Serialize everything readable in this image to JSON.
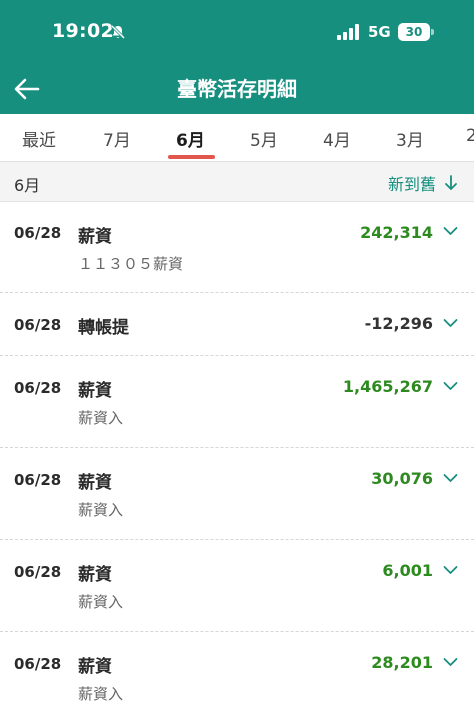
{
  "status_bar": {
    "time": "19:02",
    "network": "5G",
    "battery": "30"
  },
  "header": {
    "title": "臺幣活存明細"
  },
  "tabs": [
    {
      "label": "最近",
      "active": false
    },
    {
      "label": "7月",
      "active": false
    },
    {
      "label": "6月",
      "active": true
    },
    {
      "label": "5月",
      "active": false
    },
    {
      "label": "4月",
      "active": false
    },
    {
      "label": "3月",
      "active": false
    },
    {
      "label": "2",
      "active": false
    }
  ],
  "month_bar": {
    "month": "6月",
    "sort_label": "新到舊"
  },
  "transactions": [
    {
      "date": "06/28",
      "name": "薪資",
      "memo": "１１３０５薪資",
      "amount": "242,314",
      "sign": "positive"
    },
    {
      "date": "06/28",
      "name": "轉帳提",
      "memo": "",
      "amount": "-12,296",
      "sign": "negative"
    },
    {
      "date": "06/28",
      "name": "薪資",
      "memo": "薪資入",
      "amount": "1,465,267",
      "sign": "positive"
    },
    {
      "date": "06/28",
      "name": "薪資",
      "memo": "薪資入",
      "amount": "30,076",
      "sign": "positive"
    },
    {
      "date": "06/28",
      "name": "薪資",
      "memo": "薪資入",
      "amount": "6,001",
      "sign": "positive"
    },
    {
      "date": "06/28",
      "name": "薪資",
      "memo": "薪資入",
      "amount": "28,201",
      "sign": "positive"
    }
  ],
  "colors": {
    "header": "#178f7f",
    "accent": "#178f7f",
    "tab_indicator": "#e2574c",
    "positive_amount": "#2c8a1f",
    "negative_amount": "#333333"
  },
  "icons": {
    "back": "arrow-left-icon",
    "bell": "bell-slash-icon",
    "signal": "signal-bars-icon",
    "sort": "arrow-down-icon",
    "row_expand": "chevron-down-icon"
  }
}
